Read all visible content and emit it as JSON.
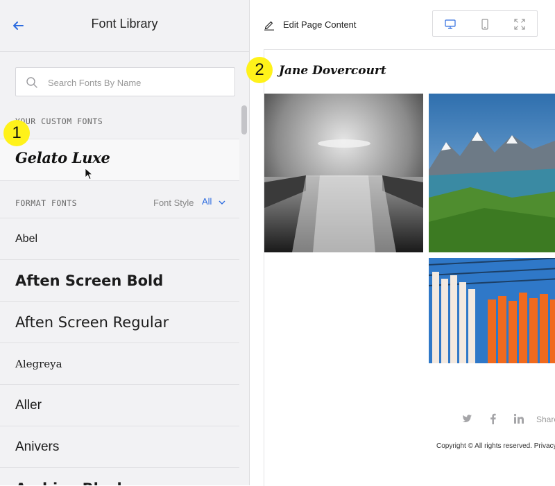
{
  "left_panel": {
    "title": "Font Library",
    "search": {
      "placeholder": "Search Fonts By Name",
      "value": ""
    },
    "custom_section_label": "YOUR CUSTOM FONTS",
    "custom_fonts": [
      "Gelato Luxe"
    ],
    "format_section_label": "FORMAT FONTS",
    "font_style_label": "Font Style",
    "font_style_value": "All",
    "fonts": [
      {
        "name": "Abel",
        "family": "\"Liberation Sans Narrow\", \"Liberation Sans\", sans-serif",
        "size": "16px",
        "weight": "normal"
      },
      {
        "name": "Aften Screen Bold",
        "family": "\"DejaVu Sans\", sans-serif",
        "size": "21px",
        "weight": "bold"
      },
      {
        "name": "Aften Screen Regular",
        "family": "\"DejaVu Sans\", sans-serif",
        "size": "21px",
        "weight": "normal"
      },
      {
        "name": "Alegreya",
        "family": "\"DejaVu Serif\", serif",
        "size": "15px",
        "weight": "normal"
      },
      {
        "name": "Aller",
        "family": "\"Liberation Sans\", sans-serif",
        "size": "19px",
        "weight": "normal"
      },
      {
        "name": "Anivers",
        "family": "\"Liberation Sans\", sans-serif",
        "size": "19px",
        "weight": "normal"
      },
      {
        "name": "Archivo Black",
        "family": "\"DejaVu Sans\", sans-serif",
        "size": "21px",
        "weight": "bold"
      }
    ]
  },
  "right_panel": {
    "edit_label": "Edit Page Content",
    "site_title": "Jane Dovercourt",
    "share_label": "Share",
    "copyright": "Copyright © All rights reserved. Privacy"
  },
  "markers": {
    "one": "1",
    "two": "2"
  },
  "colors": {
    "accent": "#2d6cdf",
    "marker": "#fff21a",
    "panel_bg": "#f2f2f4"
  },
  "icons": [
    "back-arrow-icon",
    "search-icon",
    "chevron-down-icon",
    "pencil-icon",
    "desktop-icon",
    "mobile-icon",
    "fullscreen-icon",
    "twitter-icon",
    "facebook-icon",
    "linkedin-icon",
    "cursor-icon"
  ]
}
